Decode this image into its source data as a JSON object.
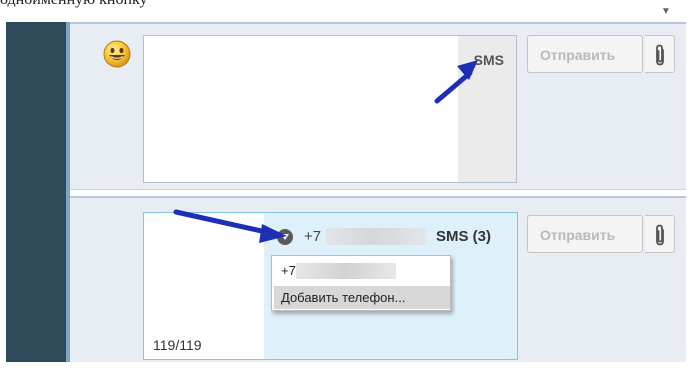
{
  "caption": "одноименную кнопку",
  "icons": {
    "smiley": "smiley-emoji-icon",
    "attach": "paperclip-icon",
    "dropdown": "chevron-down-icon",
    "scroll": "chevron-down-icon"
  },
  "top_compose": {
    "sms_label": "SMS",
    "send_label": "Отправить"
  },
  "bottom_compose": {
    "phone_prefix": "+7",
    "sms_count_label": "SMS (3)",
    "send_label": "Отправить",
    "char_counter": "119/119"
  },
  "phone_menu": {
    "items": [
      {
        "prefix": "+7"
      },
      {
        "label": "Добавить телефон..."
      }
    ]
  },
  "colors": {
    "sidebar": "#2f4a59",
    "panel_bg": "#e7edf3",
    "active_compose_border": "#7fc6e6",
    "annotation_arrow": "#1f2fb5"
  }
}
